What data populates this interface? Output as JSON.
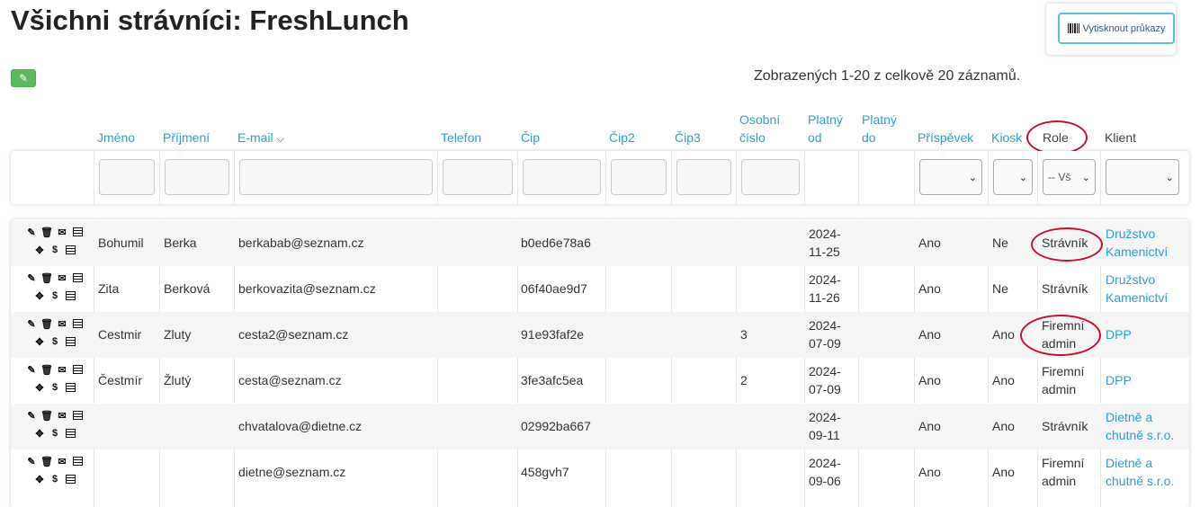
{
  "page": {
    "title": "Všichni strávníci: FreshLunch",
    "print_button_label": "Vytisknout průkazy",
    "count_text": "Zobrazených 1-20 z celkově 20 záznamů."
  },
  "icons": {
    "edit": "pencil-icon",
    "print": "barcode-icon",
    "sort": "chevron-down-icon",
    "row_actions": [
      "pencil-icon",
      "trash-icon",
      "envelope-icon",
      "list-icon",
      "move-icon",
      "dollar-icon",
      "list-lines-icon"
    ]
  },
  "colors": {
    "link": "#2a9fd6",
    "edit_button": "#5cb85c",
    "print_border": "#5bc0de",
    "highlight_ellipse": "#c8102e"
  },
  "columns": {
    "jmeno": "Jméno",
    "prijmeni": "Příjmení",
    "email": "E-mail",
    "telefon": "Telefon",
    "cip": "Čip",
    "cip2": "Čip2",
    "cip3": "Čip3",
    "osobni_1": "Osobní",
    "osobni_2": "číslo",
    "platny_od_1": "Platný",
    "platny_od_2": "od",
    "platny_do_1": "Platný",
    "platny_do_2": "do",
    "prispevek": "Příspěvek",
    "kiosk": "Kiosk",
    "role": "Role",
    "klient": "Klient"
  },
  "filters": {
    "role_selected": "-- Vš"
  },
  "rows": [
    {
      "jmeno": "Bohumil",
      "prijmeni": "Berka",
      "email": "berkabab@seznam.cz",
      "cip": "b0ed6e78a6",
      "osobni": "",
      "date1": "2024-",
      "date2": "11-25",
      "prispevek": "Ano",
      "kiosk": "Ne",
      "role1": "Strávník",
      "role2": "",
      "klient1": "Družstvo",
      "klient2": "Kamenictví"
    },
    {
      "jmeno": "Zita",
      "prijmeni": "Berková",
      "email": "berkovazita@seznam.cz",
      "cip": "06f40ae9d7",
      "osobni": "",
      "date1": "2024-",
      "date2": "11-26",
      "prispevek": "Ano",
      "kiosk": "Ne",
      "role1": "Strávník",
      "role2": "",
      "klient1": "Družstvo",
      "klient2": "Kamenictví"
    },
    {
      "jmeno": "Cestmir",
      "prijmeni": "Zluty",
      "email": "cesta2@seznam.cz",
      "cip": "91e93faf2e",
      "osobni": "3",
      "date1": "2024-",
      "date2": "07-09",
      "prispevek": "Ano",
      "kiosk": "Ano",
      "role1": "Firemní",
      "role2": "admin",
      "klient1": "DPP",
      "klient2": ""
    },
    {
      "jmeno": "Čestmír",
      "prijmeni": "Žlutý",
      "email": "cesta@seznam.cz",
      "cip": "3fe3afc5ea",
      "osobni": "2",
      "date1": "2024-",
      "date2": "07-09",
      "prispevek": "Ano",
      "kiosk": "Ano",
      "role1": "Firemní",
      "role2": "admin",
      "klient1": "DPP",
      "klient2": ""
    },
    {
      "jmeno": "",
      "prijmeni": "",
      "email": "chvatalova@dietne.cz",
      "cip": "02992ba667",
      "osobni": "",
      "date1": "2024-",
      "date2": "09-11",
      "prispevek": "Ano",
      "kiosk": "Ano",
      "role1": "Strávník",
      "role2": "",
      "klient1": "Dietně a",
      "klient2": "chutně s.r.o."
    },
    {
      "jmeno": "",
      "prijmeni": "",
      "email": "dietne@seznam.cz",
      "cip": "458gvh7",
      "osobni": "",
      "date1": "2024-",
      "date2": "09-06",
      "prispevek": "Ano",
      "kiosk": "Ano",
      "role1": "Firemní",
      "role2": "admin",
      "klient1": "Dietně a",
      "klient2": "chutně s.r.o."
    }
  ]
}
